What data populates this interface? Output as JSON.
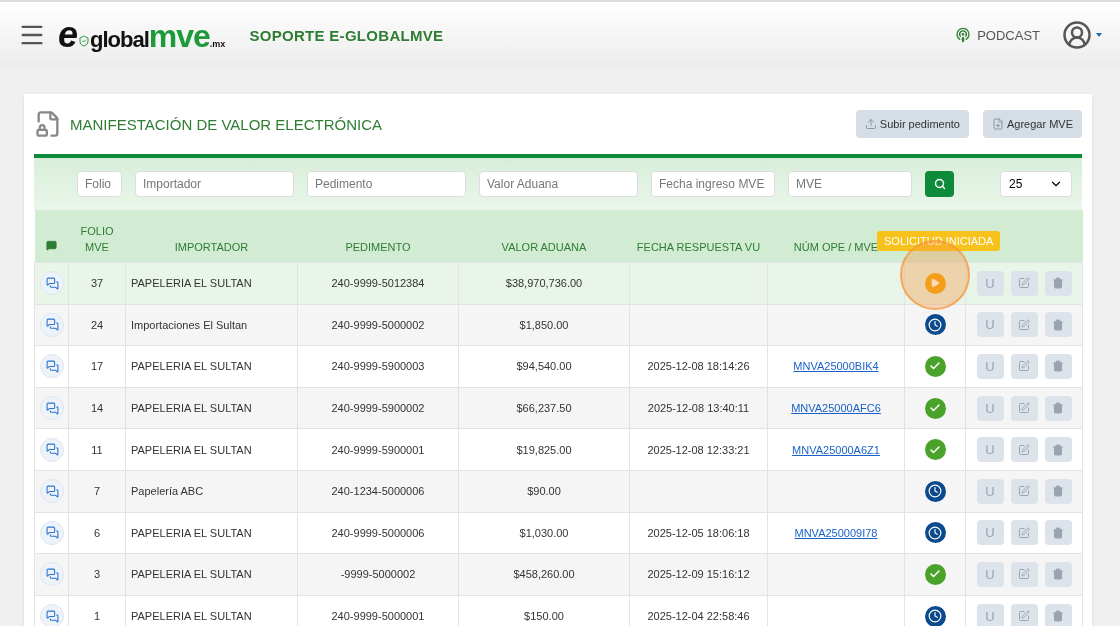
{
  "topbar": {
    "logo": {
      "e": "e",
      "global": "global",
      "mve": "mve",
      "tld": ".mx"
    },
    "title": "SOPORTE E-GLOBALMVE",
    "podcast": "PODCAST"
  },
  "card": {
    "title": "MANIFESTACIÓN DE VALOR ELECTRÓNICA",
    "buttons": [
      {
        "kind": "upload",
        "label": "Subir pedimento"
      },
      {
        "kind": "add",
        "label": "Agregar MVE"
      }
    ]
  },
  "filters": [
    {
      "placeholder": "Folio"
    },
    {
      "placeholder": "Importador"
    },
    {
      "placeholder": "Pedimento"
    },
    {
      "placeholder": "Valor Aduana"
    },
    {
      "placeholder": "Fecha ingreso MVE"
    },
    {
      "placeholder": "MVE"
    }
  ],
  "page_size": "25",
  "columns": [
    "FOLIO MVE",
    "IMPORTADOR",
    "PEDIMENTO",
    "VALOR ADUANA",
    "FECHA RESPUESTA VU",
    "NÚM OPE / MVE"
  ],
  "tooltip": "SOLICITUD INICIADA",
  "rows": [
    {
      "folio": "37",
      "importador": "PAPELERIA EL SULTAN",
      "pedimento": "240-9999-5012384",
      "valor": "$38,970,736.00",
      "fecha": "",
      "ope": "",
      "kind": "started",
      "selected": true,
      "u": "U"
    },
    {
      "folio": "24",
      "importador": "Importaciones El Sultan",
      "pedimento": "240-9999-5000002",
      "valor": "$1,850.00",
      "fecha": "",
      "ope": "",
      "kind": "pending",
      "selected": false,
      "u": "U"
    },
    {
      "folio": "17",
      "importador": "PAPELERIA EL SULTAN",
      "pedimento": "240-9999-5900003",
      "valor": "$94,540.00",
      "fecha": "2025-12-08 18:14:26",
      "ope": "MNVA25000BIK4",
      "kind": "done",
      "selected": false,
      "u": "U"
    },
    {
      "folio": "14",
      "importador": "PAPELERIA EL SULTAN",
      "pedimento": "240-9999-5900002",
      "valor": "$66,237.50",
      "fecha": "2025-12-08 13:40:11",
      "ope": "MNVA25000AFC6",
      "kind": "done",
      "selected": false,
      "u": "U"
    },
    {
      "folio": "11",
      "importador": "PAPELERIA EL SULTAN",
      "pedimento": "240-9999-5900001",
      "valor": "$19,825.00",
      "fecha": "2025-12-08 12:33:21",
      "ope": "MNVA25000A6Z1",
      "kind": "done",
      "selected": false,
      "u": "U"
    },
    {
      "folio": "7",
      "importador": "Papelería ABC",
      "pedimento": "240-1234-5000006",
      "valor": "$90.00",
      "fecha": "",
      "ope": "",
      "kind": "pending",
      "selected": false,
      "u": "U"
    },
    {
      "folio": "6",
      "importador": "PAPELERIA EL SULTAN",
      "pedimento": "240-9999-5000006",
      "valor": "$1,030.00",
      "fecha": "2025-12-05 18:06:18",
      "ope": "MNVA250009I78",
      "kind": "pending",
      "selected": false,
      "u": "U"
    },
    {
      "folio": "3",
      "importador": "PAPELERIA EL SULTAN",
      "pedimento": "-9999-5000002",
      "valor": "$458,260.00",
      "fecha": "2025-12-09 15:16:12",
      "ope": "",
      "kind": "done",
      "selected": false,
      "u": "U"
    },
    {
      "folio": "1",
      "importador": "PAPELERIA EL SULTAN",
      "pedimento": "240-9999-5000001",
      "valor": "$150.00",
      "fecha": "2025-12-04 22:58:46",
      "ope": "",
      "kind": "pending",
      "selected": false,
      "u": "U"
    }
  ]
}
